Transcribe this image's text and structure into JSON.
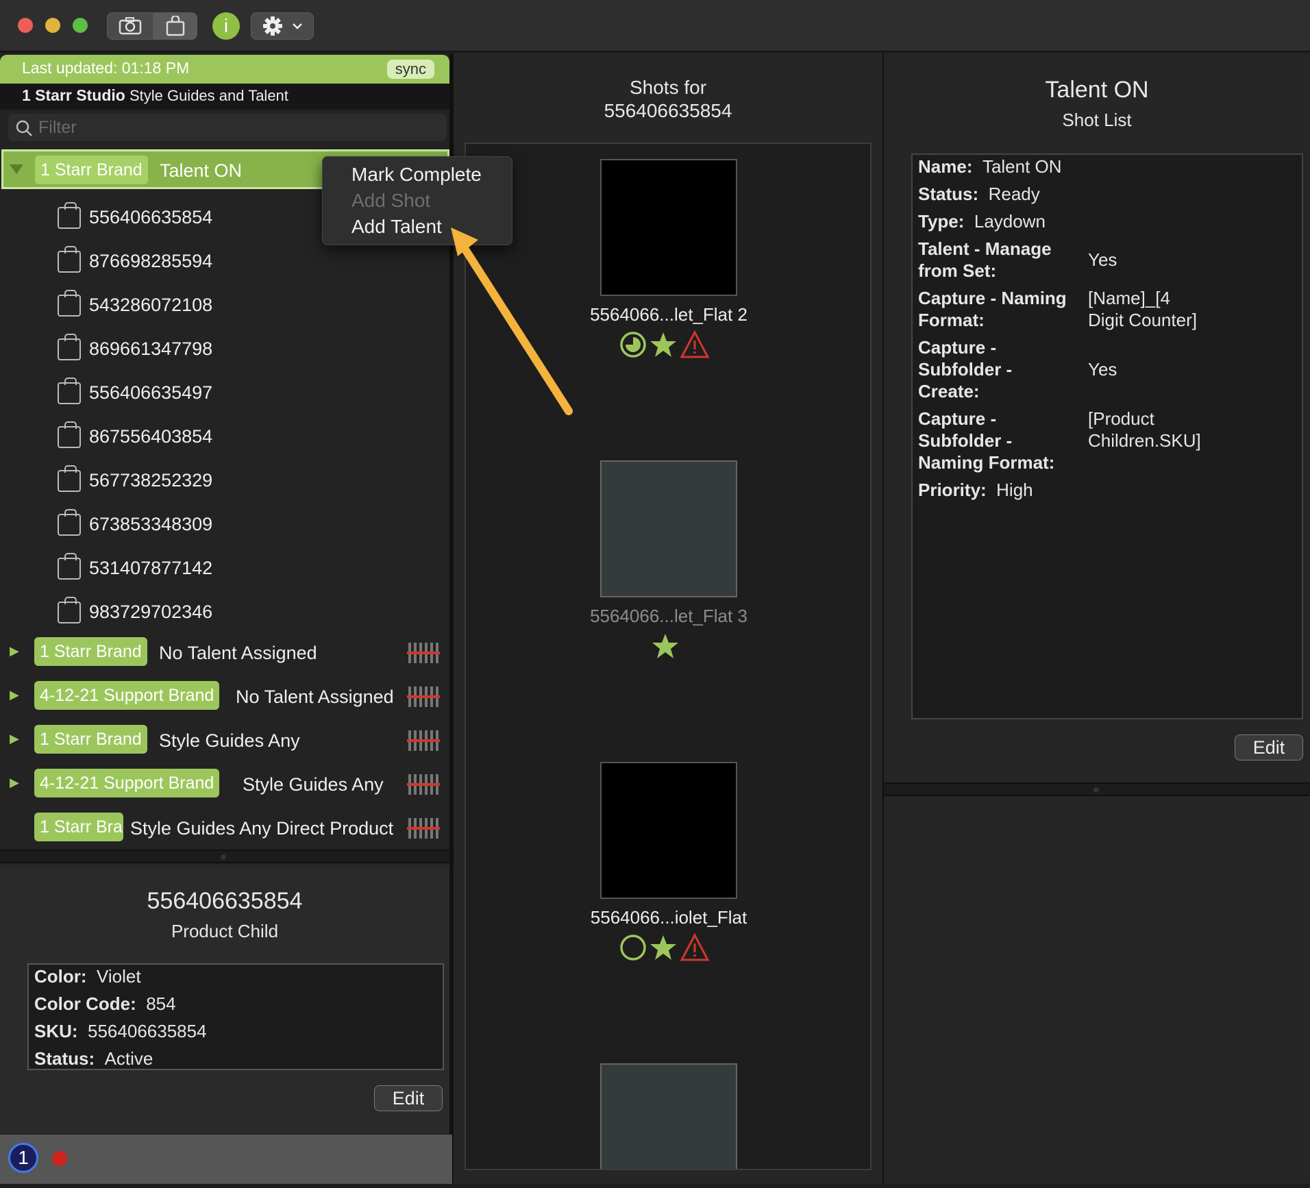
{
  "toolbar": {
    "info_glyph": "i"
  },
  "left": {
    "last_updated": "Last updated: 01:18 PM",
    "sync": "sync",
    "studio_name": "1 Starr Studio",
    "studio_sub": "Style Guides and Talent",
    "filter_placeholder": "Filter",
    "selected": {
      "badge": "1 Starr Brand",
      "label": "Talent ON"
    },
    "children": [
      "556406635854",
      "876698285594",
      "543286072108",
      "869661347798",
      "556406635497",
      "867556403854",
      "567738252329",
      "673853348309",
      "531407877142",
      "983729702346"
    ],
    "groups": [
      {
        "badge": "1 Starr Brand",
        "label": "No Talent Assigned"
      },
      {
        "badge": "4-12-21 Support Brand",
        "label": "No Talent Assigned"
      },
      {
        "badge": "1 Starr Brand",
        "label": "Style Guides Any"
      },
      {
        "badge": "4-12-21 Support Brand",
        "label": "Style Guides Any"
      },
      {
        "badge": "1 Starr Bra",
        "label": "Style Guides Any Direct Product"
      }
    ],
    "detail": {
      "title": "556406635854",
      "subtitle": "Product Child",
      "color_label": "Color:",
      "color": "Violet",
      "code_label": "Color Code:",
      "code": "854",
      "sku_label": "SKU:",
      "sku": "556406635854",
      "status_label": "Status:",
      "status": "Active",
      "edit": "Edit"
    }
  },
  "context_menu": {
    "mark_complete": "Mark Complete",
    "add_shot": "Add Shot",
    "add_talent": "Add Talent"
  },
  "middle": {
    "title_line1": "Shots for",
    "title_line2": "556406635854",
    "shots": [
      {
        "label": "5564066...let_Flat 2"
      },
      {
        "label": "5564066...let_Flat 3"
      },
      {
        "label": "5564066...iolet_Flat"
      }
    ]
  },
  "right": {
    "title": "Talent ON",
    "subtitle": "Shot List",
    "name_label": "Name:",
    "name": "Talent ON",
    "status_label": "Status:",
    "status": "Ready",
    "type_label": "Type:",
    "type": "Laydown",
    "talent_label_1": "Talent - Manage",
    "talent_label_2": "from Set:",
    "talent": "Yes",
    "naming_label_1": "Capture - Naming",
    "naming_label_2": "Format:",
    "naming_1": "[Name]_[4",
    "naming_2": "Digit Counter]",
    "subcreate_label_1": "Capture -",
    "subcreate_label_2": "Subfolder -",
    "subcreate_label_3": "Create:",
    "subcreate": "Yes",
    "subname_label_1": "Capture -",
    "subname_label_2": "Subfolder -",
    "subname_label_3": "Naming Format:",
    "subname_1": "[Product",
    "subname_2": "Children.SKU]",
    "priority_label": "Priority:",
    "priority": "High",
    "edit": "Edit"
  },
  "colors": {
    "accent_green": "#9cc65c",
    "warning_red": "#d0382c",
    "arrow": "#f3b33d"
  }
}
